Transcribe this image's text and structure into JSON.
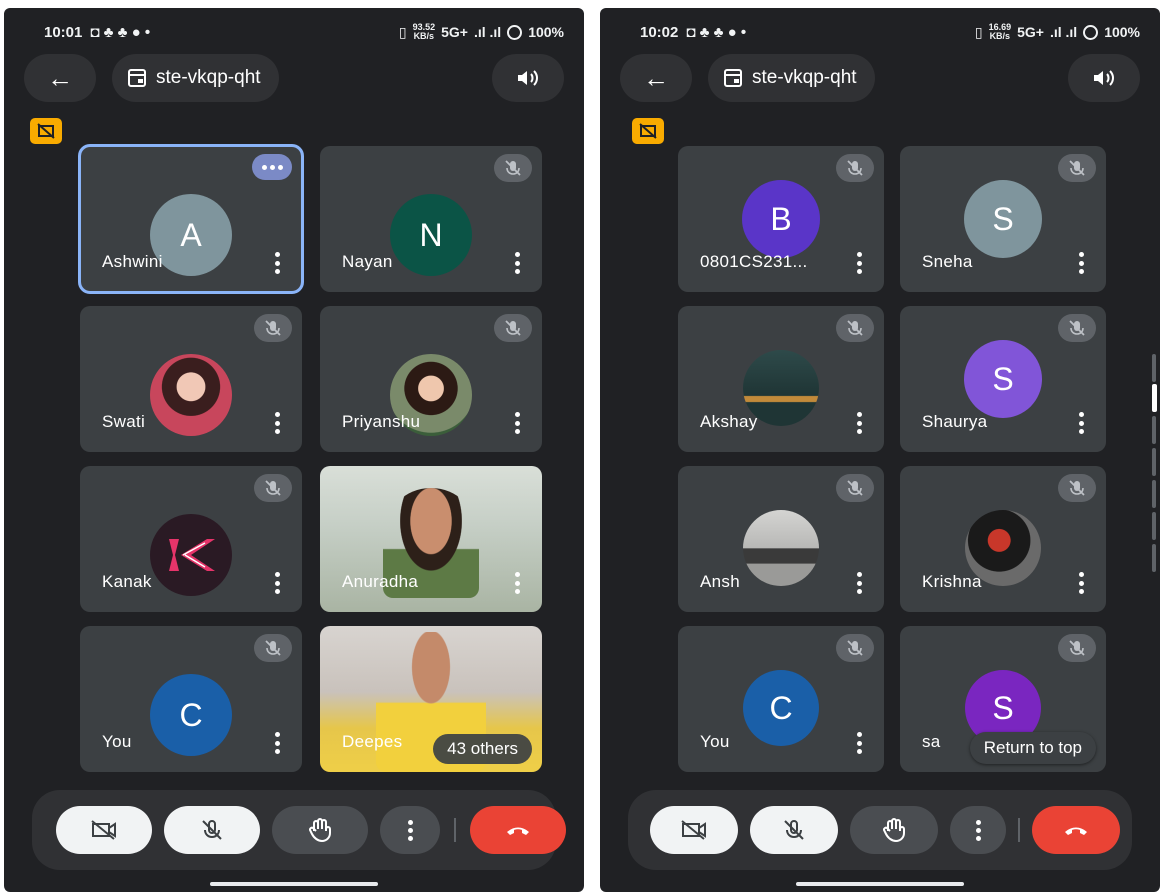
{
  "colors": {
    "background": "#202124",
    "tile": "#3c4043",
    "active_outline": "#8ab4f8",
    "end_call": "#ea4335",
    "badge": "#f9ab00"
  },
  "left_screen": {
    "status": {
      "time": "10:01",
      "speed_value": "93.52",
      "speed_unit": "KB/s",
      "network": "5G+",
      "battery": "100%"
    },
    "meeting_code": "ste-vkqp-qht",
    "tiles": [
      {
        "name": "Ashwini",
        "initial": "A",
        "avatar_color": "#7f959d"
      },
      {
        "name": "Nayan",
        "initial": "N",
        "avatar_color": "#0b5446"
      },
      {
        "name": "Swati"
      },
      {
        "name": "Priyanshu"
      },
      {
        "name": "Kanak"
      },
      {
        "name": "Anuradha"
      },
      {
        "name": "You",
        "initial": "C",
        "avatar_color": "#1a5fa8"
      },
      {
        "name": "Deepes",
        "overlay": "43 others"
      }
    ]
  },
  "right_screen": {
    "status": {
      "time": "10:02",
      "speed_value": "16.69",
      "speed_unit": "KB/s",
      "network": "5G+",
      "battery": "100%"
    },
    "meeting_code": "ste-vkqp-qht",
    "tiles": [
      {
        "name": "0801CS231...",
        "initial": "B",
        "avatar_color": "#5a35c8"
      },
      {
        "name": "Sneha",
        "initial": "S",
        "avatar_color": "#7f959d"
      },
      {
        "name": "Akshay"
      },
      {
        "name": "Shaurya",
        "initial": "S",
        "avatar_color": "#8155d8"
      },
      {
        "name": "Ansh"
      },
      {
        "name": "Krishna"
      },
      {
        "name": "You",
        "initial": "C",
        "avatar_color": "#1a5fa8"
      },
      {
        "name": "sa",
        "overlay": "Return to top",
        "initial": "S",
        "avatar_color": "#7a26c0"
      }
    ]
  },
  "icons": {
    "back": "arrow-left-icon",
    "calendar": "calendar-icon",
    "speaker": "speaker-icon",
    "camera_off": "camera-off-icon",
    "mic_off": "mic-off-icon",
    "hand": "raise-hand-icon",
    "more": "more-vert-icon",
    "end_call": "end-call-icon"
  }
}
